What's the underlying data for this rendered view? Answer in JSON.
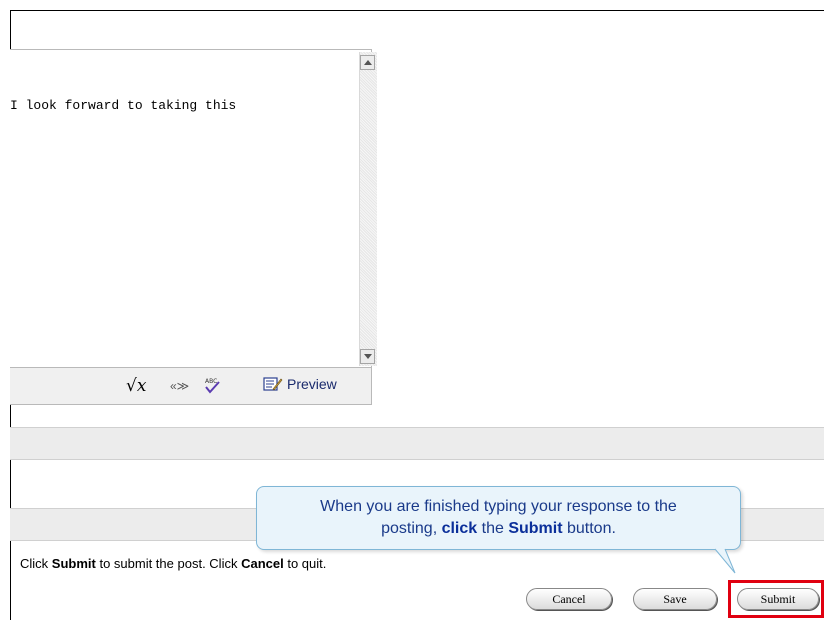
{
  "editor": {
    "text": "I look forward to taking this"
  },
  "toolbar": {
    "equation_icon": "√x",
    "link_icon": "«≫",
    "spell_icon_label": "ABC",
    "preview_label": "Preview"
  },
  "instruction": {
    "part1": "Click ",
    "submit": "Submit",
    "part2": " to submit the post. Click ",
    "cancel": "Cancel",
    "part3": " to quit."
  },
  "buttons": {
    "cancel": "Cancel",
    "save": "Save",
    "submit": "Submit"
  },
  "callout": {
    "line1": "When you are finished typing your response to the",
    "line2_a": "posting, ",
    "line2_click": "click",
    "line2_b": " the ",
    "line2_submit": "Submit",
    "line2_c": " button."
  },
  "colors": {
    "highlight": "#e00010",
    "callout_bg": "#e9f4fb",
    "callout_text": "#1a3a8a"
  }
}
